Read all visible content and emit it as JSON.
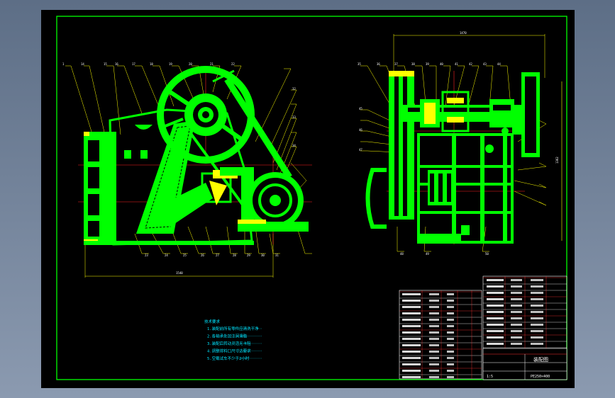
{
  "title_block": {
    "drawing_title": "装配图",
    "drawing_number": "PE250×400",
    "scale": "1:5"
  },
  "dimensions": {
    "overall_length": "1540",
    "top_width": "1470",
    "height": "1362"
  },
  "technical_notes": {
    "heading": "技术要求",
    "items": [
      "1.装配前所有零件应清洗干净",
      "2.各轴承处加注润滑脂",
      "3.装配后转动灵活无卡阻",
      "4.调整排料口尺寸达要求",
      "5.空载试车不少于2小时"
    ]
  },
  "balloons_front_top": [
    "1",
    "14",
    "15",
    "16",
    "17",
    "18",
    "19",
    "20",
    "21",
    "22"
  ],
  "balloons_front_bottom": [
    "23",
    "24",
    "25",
    "26",
    "27",
    "28",
    "29",
    "30",
    "31",
    "32",
    "33",
    "34"
  ],
  "balloons_side_top": [
    "35",
    "36",
    "37",
    "38",
    "39",
    "40",
    "41",
    "42",
    "43",
    "44",
    "45",
    "46",
    "47"
  ],
  "balloons_side_bottom": [
    "48",
    "49",
    "50"
  ],
  "colors": {
    "background": "#000000",
    "frame": "#00ff00",
    "part_fill": "#00ff00",
    "bearing_fill": "#ffff00",
    "leader": "#ffff00",
    "centerline": "#ff0000",
    "table_red": "#ff3333",
    "table_white": "#ffffff",
    "notes": "#00e5ff",
    "viewport_bg": "#5d6e86"
  }
}
